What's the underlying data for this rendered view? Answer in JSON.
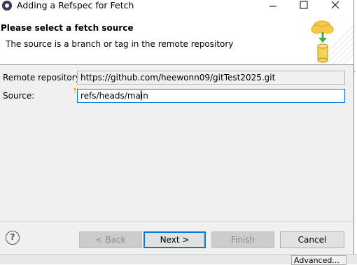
{
  "window": {
    "title": "Adding a Refspec for Fetch",
    "minimize_icon": "minimize-icon",
    "maximize_icon": "maximize-icon",
    "close_icon": "close-icon"
  },
  "header": {
    "title": "Please select a fetch source",
    "description": "The source is a branch or tag in the remote repository",
    "graphic_icon": "cloud-download-database-icon"
  },
  "form": {
    "remote_label": "Remote repository:",
    "remote_value": "https://github.com/heewonn09/gitTest2025.git",
    "source_label": "Source:",
    "source_value": "refs/heads/main"
  },
  "buttons": {
    "help_label": "?",
    "back_label": "< Back",
    "next_label": "Next >",
    "finish_label": "Finish",
    "cancel_label": "Cancel"
  },
  "background": {
    "advanced_label": "Advanced...",
    "partial_char": "i"
  },
  "colors": {
    "dialog_bg": "#f0f0f0",
    "header_bg": "#ffffff",
    "focus_border": "#0078d7",
    "cloud": "#f5c342",
    "arrow": "#3cb043"
  }
}
